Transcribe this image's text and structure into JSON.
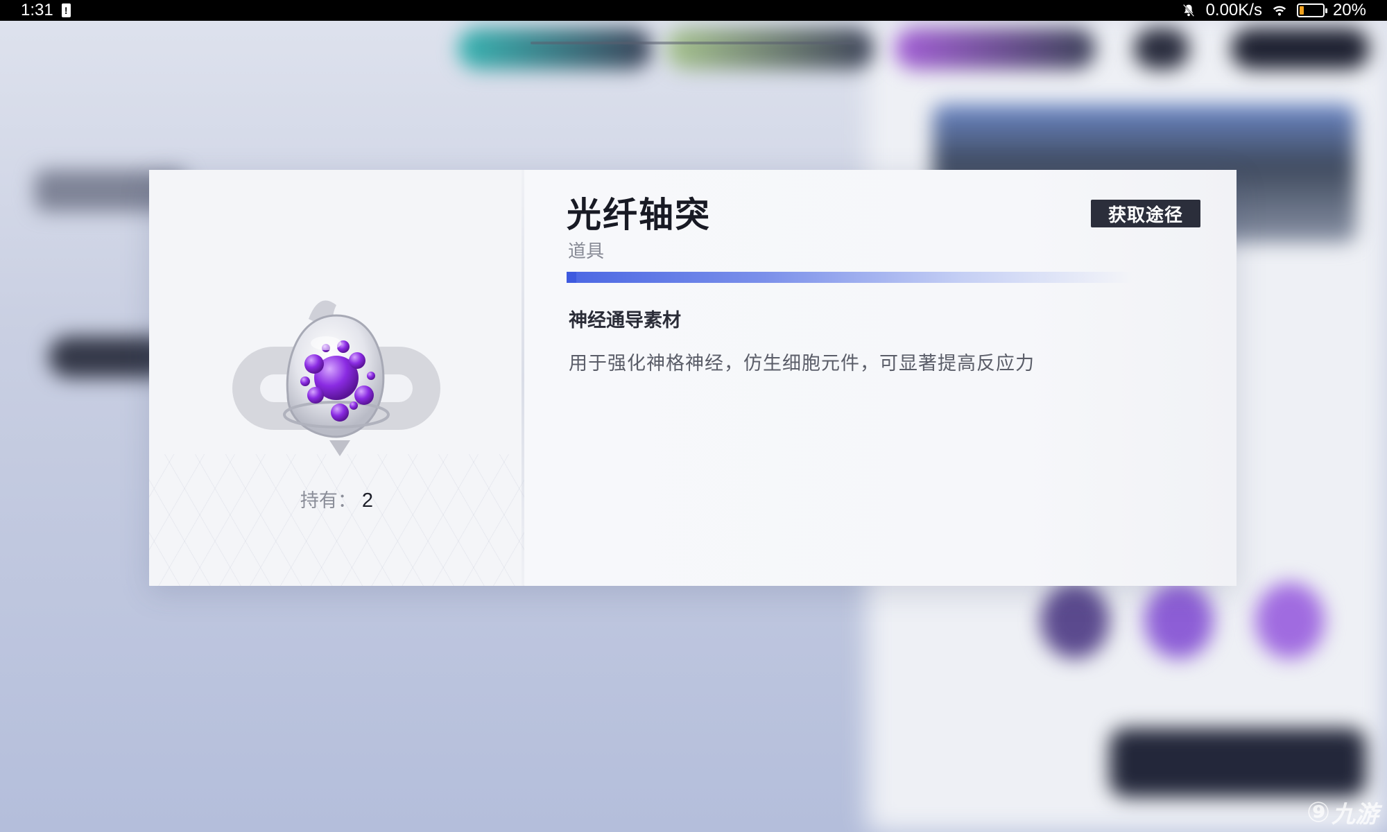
{
  "status_bar": {
    "time": "1:31",
    "network_speed": "0.00K/s",
    "battery": "20%",
    "icons": [
      "alert-icon",
      "mute-bell-icon",
      "wifi-icon",
      "battery-icon"
    ]
  },
  "item": {
    "name": "光纤轴突",
    "type": "道具",
    "category": "神经通导素材",
    "description": "用于强化神格神经，仿生细胞元件，可显著提高反应力",
    "hold_label": "持有：",
    "hold_count": "2",
    "source_button": "获取途径",
    "icon": "purple-orb-icon",
    "rarity_color": "#4b67e3"
  },
  "watermark": {
    "logo": "9-icon",
    "text": "九游"
  }
}
